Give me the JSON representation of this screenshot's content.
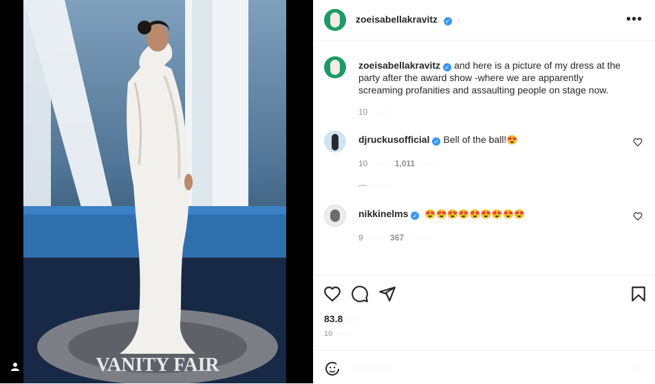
{
  "post": {
    "image_alt": "Woman in long white gown on a Vanity Fair party carpet",
    "author": "zoeisabellakravitz",
    "caption": "and here is a picture of my dress at the party after the award show -where we are apparently screaming profanities and assaulting people on stage now.",
    "caption_time": "10",
    "likes": "83.8",
    "date": "10"
  },
  "comments": [
    {
      "username": "djruckusofficial",
      "text": "Bell of the ball!",
      "emoji": "😍",
      "time": "10",
      "likes": "1,011"
    },
    {
      "username": "nikkinelms",
      "text": "",
      "emoji": "😍😍😍😍😍😍😍😍😍",
      "time": "9",
      "likes": "367"
    }
  ],
  "photo": {
    "sign_text": "VANITY FAIR"
  },
  "colors": {
    "verified": "#3897f0",
    "avatar_zoe": "#1a9b63",
    "muted": "#8e8e8e"
  },
  "icons": [
    "more-icon",
    "heart-icon",
    "comment-icon",
    "share-icon",
    "bookmark-icon",
    "emoji-icon",
    "user-tag-icon",
    "verified-icon"
  ]
}
